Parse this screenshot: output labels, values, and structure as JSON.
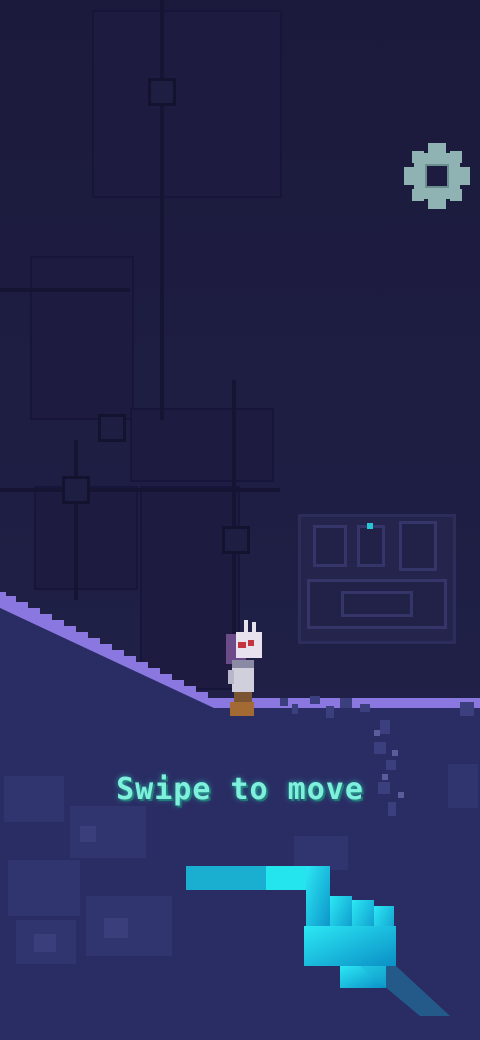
{
  "tutorial": {
    "hint": "Swipe to move",
    "gesture": "swipe-right"
  },
  "hud": {
    "settings_icon": "gear-icon"
  },
  "colors": {
    "background": "#1c1c3e",
    "ground": "#2b2e66",
    "ground_edge": "#8a78e0",
    "hint_text": "#7ff0dc",
    "swipe_bar": "#24e4ee",
    "settings_gear": "#8fb3b3"
  }
}
